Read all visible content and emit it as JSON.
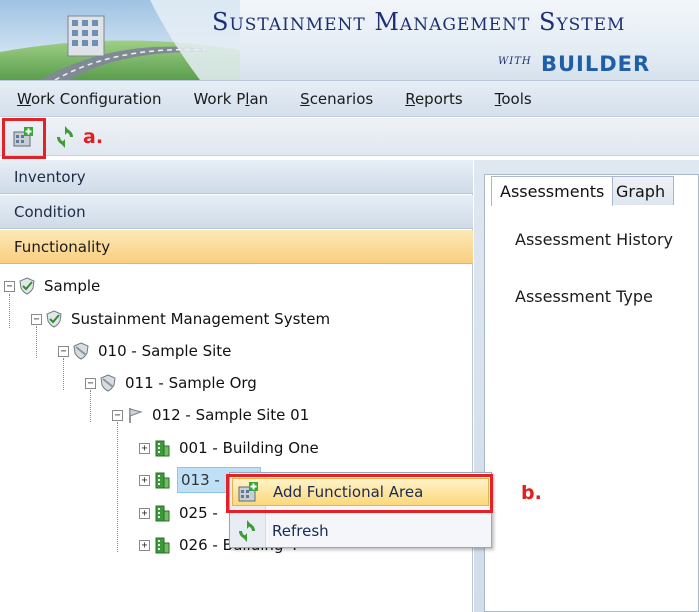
{
  "banner": {
    "title": "Sustainment Management System",
    "with": "WITH",
    "builder": "BUILDER"
  },
  "menu": [
    {
      "mnemonic": "W",
      "rest": "ork Configuration"
    },
    {
      "pre": "Work P",
      "mnemonic": "l",
      "rest": "an"
    },
    {
      "mnemonic": "S",
      "rest": "cenarios"
    },
    {
      "mnemonic": "R",
      "rest": "eports"
    },
    {
      "mnemonic": "T",
      "rest": "ools"
    }
  ],
  "toolbar": {
    "callout_a": "a.",
    "add_icon": "add-building-icon",
    "refresh_icon": "refresh-icon"
  },
  "nav": {
    "inventory": "Inventory",
    "condition": "Condition",
    "functionality": "Functionality"
  },
  "tree": {
    "sample": "Sample",
    "sms": "Sustainment Management System",
    "site010": "010 - Sample Site",
    "org011": "011 - Sample Org",
    "site012": "012 - Sample Site 01",
    "b001": "001 - Building One",
    "b013": "013 -",
    "b025": "025 -",
    "b026": "026 - Building 4"
  },
  "tabs": {
    "assessments": "Assessments",
    "graph": "Graph"
  },
  "fields": {
    "history": "Assessment History",
    "type": "Assessment Type"
  },
  "context_menu": {
    "add_functional_area": "Add Functional Area",
    "refresh": "Refresh",
    "callout_b": "b."
  },
  "colors": {
    "highlight": "#e32127",
    "nav_active": "#f8cf80",
    "title_blue": "#1c2f73"
  }
}
